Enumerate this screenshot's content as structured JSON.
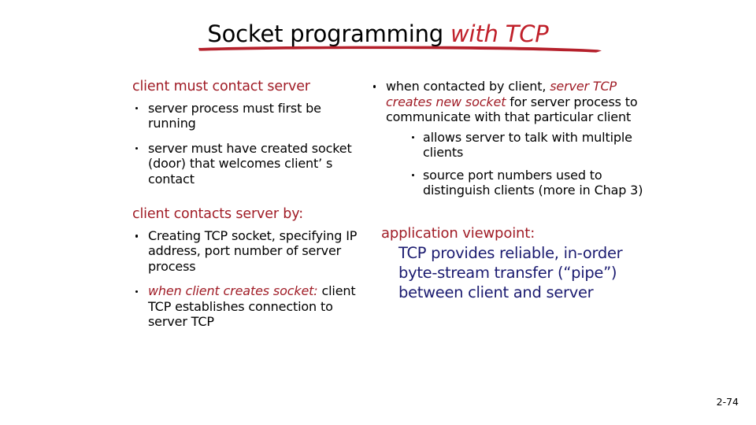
{
  "slide": {
    "title": {
      "main": "Socket programming",
      "accent": "with TCP"
    },
    "page_number": "2-74",
    "colors": {
      "title_accent_red": "#C0202A",
      "heading_red": "#A01C26",
      "body_black": "#000000",
      "viewpoint_blue": "#1B1B70",
      "background": "#FFFFFF"
    }
  },
  "left_column": {
    "heading_1": "client must contact server",
    "bullets_1": [
      "server process must first be running",
      "server must have created socket (door) that welcomes client’ s contact"
    ],
    "heading_2": "client contacts server by:",
    "bullets_2": [
      {
        "emphasis": "",
        "text": "Creating TCP socket, specifying IP address, port number of server process"
      },
      {
        "emphasis": "when client creates socket:",
        "text": "client TCP establishes connection to server TCP"
      }
    ]
  },
  "right_column": {
    "bullet_lead": "when contacted by client,",
    "bullet_emphasis": "server TCP creates new socket",
    "bullet_tail": "for server process to communicate with that particular client",
    "sub_bullets": [
      "allows server to talk with multiple clients",
      "source port numbers used to distinguish clients (more in Chap 3)"
    ],
    "viewpoint_heading": "application viewpoint:",
    "viewpoint_body": "TCP provides reliable, in-order byte-stream transfer (“pipe”) between client and server"
  }
}
